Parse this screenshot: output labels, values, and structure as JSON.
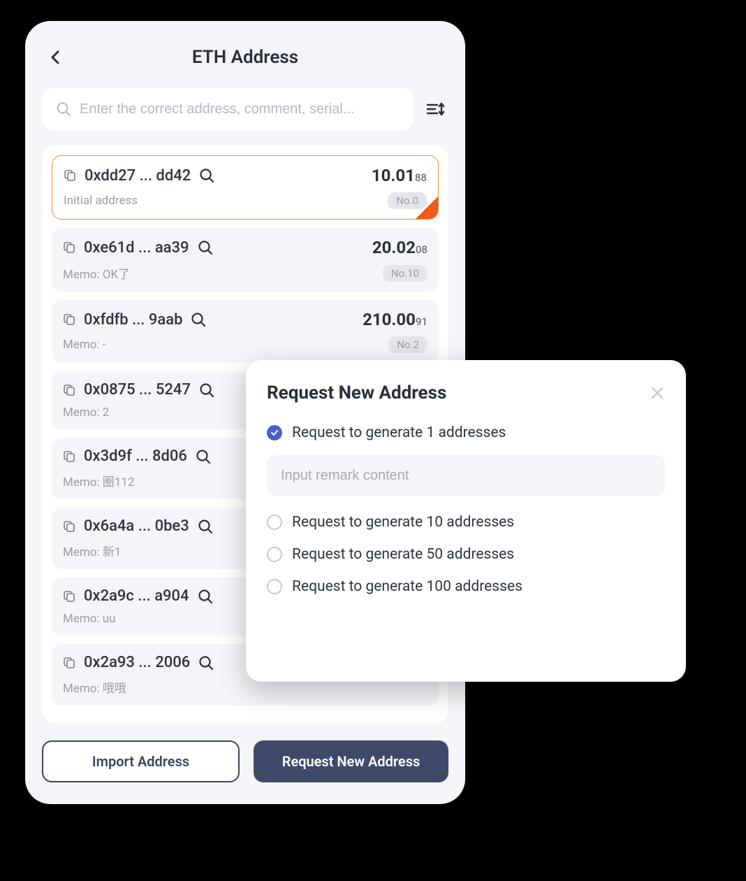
{
  "header": {
    "title": "ETH Address"
  },
  "search": {
    "placeholder": "Enter the correct address, comment, serial..."
  },
  "addresses": [
    {
      "addr": "0xdd27 ... dd42",
      "balance": "10.01",
      "balance_sub": "88",
      "memo": "Initial address",
      "badge": "No.0",
      "selected": true
    },
    {
      "addr": "0xe61d ... aa39",
      "balance": "20.02",
      "balance_sub": "08",
      "memo": "Memo: OK了",
      "badge": "No.10",
      "selected": false
    },
    {
      "addr": "0xfdfb ... 9aab",
      "balance": "210.00",
      "balance_sub": "91",
      "memo": "Memo: -",
      "badge": "No.2",
      "selected": false
    },
    {
      "addr": "0x0875 ... 5247",
      "balance": "",
      "balance_sub": "",
      "memo": "Memo: 2",
      "badge": "",
      "selected": false
    },
    {
      "addr": "0x3d9f ... 8d06",
      "balance": "",
      "balance_sub": "",
      "memo": "Memo: 圈112",
      "badge": "",
      "selected": false
    },
    {
      "addr": "0x6a4a ... 0be3",
      "balance": "",
      "balance_sub": "",
      "memo": "Memo: 新1",
      "badge": "",
      "selected": false
    },
    {
      "addr": "0x2a9c ... a904",
      "balance": "",
      "balance_sub": "",
      "memo": "Memo: uu",
      "badge": "",
      "selected": false
    },
    {
      "addr": "0x2a93 ... 2006",
      "balance": "",
      "balance_sub": "",
      "memo": "Memo: 哦哦",
      "badge": "",
      "selected": false
    }
  ],
  "buttons": {
    "import": "Import Address",
    "request": "Request New Address"
  },
  "modal": {
    "title": "Request New Address",
    "options": [
      {
        "label": "Request to generate 1 addresses",
        "checked": true
      },
      {
        "label": "Request to generate 10 addresses",
        "checked": false
      },
      {
        "label": "Request to generate 50 addresses",
        "checked": false
      },
      {
        "label": "Request to generate 100 addresses",
        "checked": false
      }
    ],
    "remark_placeholder": "Input remark content"
  }
}
